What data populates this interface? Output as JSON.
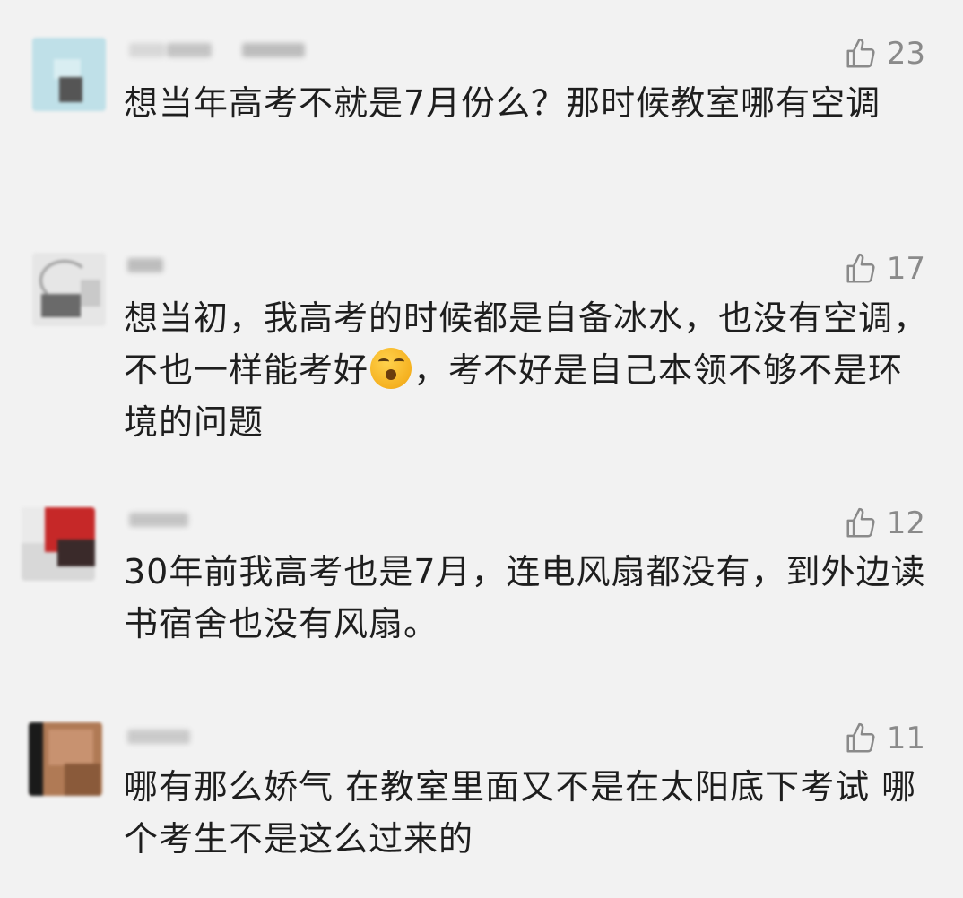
{
  "comments": [
    {
      "likes": "23",
      "text": "想当年高考不就是7月份么？那时候教室哪有空调",
      "colors": {
        "avatar_main": "#bfe0e8",
        "avatar_accent": "#555555"
      }
    },
    {
      "likes": "17",
      "text_before_emoji": "想当初，我高考的时候都是自备冰水，也没有空调，不也一样能考好",
      "emoji_icon": "kiss-face-emoji",
      "text_after_emoji": "，考不好是自己本领不够不是环境的问题",
      "colors": {
        "avatar_main": "#e6e6e6",
        "avatar_accent": "#6a6a6a"
      }
    },
    {
      "likes": "12",
      "text": "30年前我高考也是7月，连电风扇都没有，到外边读书宿舍也没有风扇。",
      "colors": {
        "avatar_main": "#c62828",
        "avatar_accent": "#3a2a2a"
      }
    },
    {
      "likes": "11",
      "text": "哪有那么娇气 在教室里面又不是在太阳底下考试 哪个考生不是这么过来的",
      "colors": {
        "avatar_main": "#b07a55",
        "avatar_accent": "#1a1a1a"
      }
    }
  ],
  "icons": {
    "like": "thumbs-up-icon"
  },
  "colors": {
    "background": "#f2f2f2",
    "text": "#1e1e1e",
    "muted": "#8a8a8a"
  }
}
